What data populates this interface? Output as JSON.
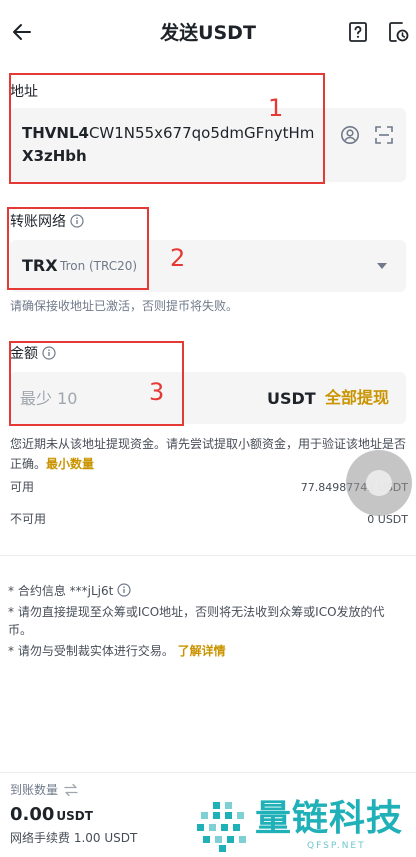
{
  "header": {
    "title": "发送USDT",
    "back_icon": "arrow-left-icon",
    "help_icon": "question-icon",
    "history_icon": "history-icon"
  },
  "address": {
    "label": "地址",
    "value_bold_prefix": "THVNL4",
    "value_middle": "CW1N55x677qo5dmGFnytHm",
    "value_bold_suffix": "X3zHbh"
  },
  "network": {
    "label": "转账网络",
    "code": "TRX",
    "name": "Tron (TRC20)",
    "hint": "请确保接收地址已激活，否则提币将失败。"
  },
  "amount": {
    "label": "金额",
    "placeholder": "最少 10",
    "unit": "USDT",
    "max_label": "全部提现",
    "warning": "您近期未从该地址提现资金。请先尝试提取小额资金，用于验证该地址是否正确。",
    "warning_link": "最小数量"
  },
  "balances": {
    "available_label": "可用",
    "available_value": "77.84987742 USDT",
    "unavailable_label": "不可用",
    "unavailable_value": "0 USDT"
  },
  "notes": {
    "contract": "* 合约信息 ***jLj6t",
    "ico": "* 请勿直接提现至众筹或ICO地址，否则将无法收到众筹或ICO发放的代币。",
    "sanction": "* 请勿与受制裁实体进行交易。",
    "sanction_link": "了解详情"
  },
  "footer": {
    "receive_label": "到账数量",
    "receive_amount": "0.00",
    "receive_unit": "USDT",
    "fee": "网络手续费 1.00 USDT"
  },
  "annotations": [
    "1",
    "2",
    "3"
  ],
  "watermark": {
    "text": "量链科技",
    "sub": "QFSP.NET"
  },
  "colors": {
    "accent": "#c99400",
    "annotation": "#e53935",
    "input_bg": "#f5f5f5",
    "watermark": "#1fb0b8"
  }
}
